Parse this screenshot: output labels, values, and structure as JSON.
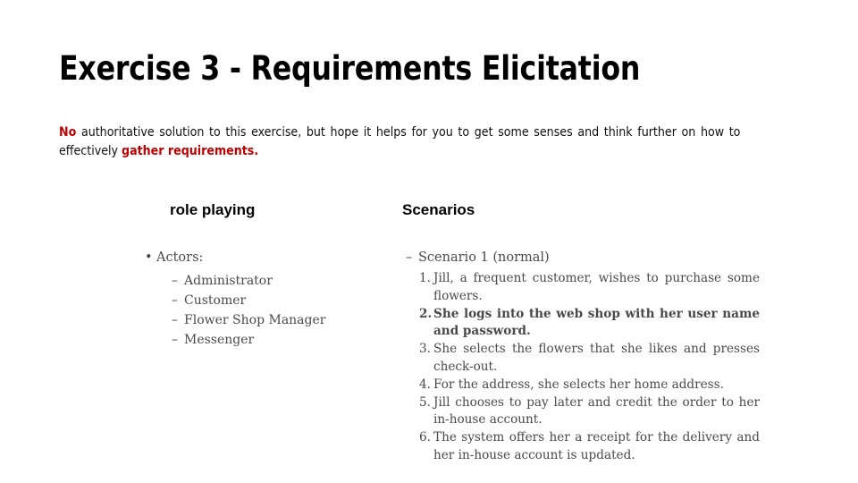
{
  "slide": {
    "title": "Exercise 3 - Requirements Elicitation",
    "accent_color": "#C00000",
    "intro": {
      "lead": "No",
      "middle": " authoritative solution to this exercise, but hope it helps for you to get some senses and think further on how to effectively ",
      "highlight": "gather requirements",
      "tail": "."
    },
    "columns": {
      "left": {
        "heading": "role playing",
        "figure": {
          "bullet_marker": "•",
          "bullet_label": "Actors:",
          "dash_marker": "–",
          "items": [
            "Administrator",
            "Customer",
            "Flower Shop Manager",
            "Messenger"
          ]
        }
      },
      "right": {
        "heading": "Scenarios",
        "figure": {
          "dash_marker": "–",
          "scenario_label": "Scenario 1 (normal)",
          "steps": [
            "Jill, a frequent customer, wishes to purchase some flowers.",
            "She logs into the web shop with her user name and password.",
            "She selects the flowers that she likes and presses check-out.",
            "For the address, she selects her home address.",
            "Jill chooses to pay later and credit the order to her in-house account.",
            "The system offers her a receipt for the delivery and her in-house account is updated."
          ],
          "step_numbers": [
            "1.",
            "2.",
            "3.",
            "4.",
            "5.",
            "6."
          ]
        }
      }
    }
  }
}
